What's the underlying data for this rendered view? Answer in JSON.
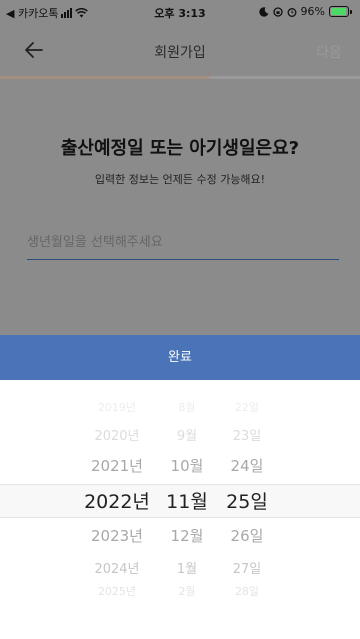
{
  "status_bar": {
    "carrier": "◀ 카카오톡",
    "time": "오후 3:13",
    "battery": "96%"
  },
  "nav": {
    "title": "회원가입",
    "next_label": "다음"
  },
  "progress": {
    "fraction": 0.58
  },
  "heading": "출산예정일 또는 아기생일은요?",
  "subheading": "입력한 정보는 언제든 수정 가능해요!",
  "date_field": {
    "placeholder": "생년월일을 선택해주세요"
  },
  "done_label": "완료",
  "picker": {
    "years": [
      "2019년",
      "2020년",
      "2021년",
      "2022년",
      "2023년",
      "2024년",
      "2025년"
    ],
    "months": [
      "8월",
      "9월",
      "10월",
      "11월",
      "12월",
      "1월",
      "2월"
    ],
    "days": [
      "22일",
      "23일",
      "24일",
      "25일",
      "26일",
      "27일",
      "28일"
    ],
    "selected": {
      "year": "2022년",
      "month": "11월",
      "day": "25일"
    }
  }
}
